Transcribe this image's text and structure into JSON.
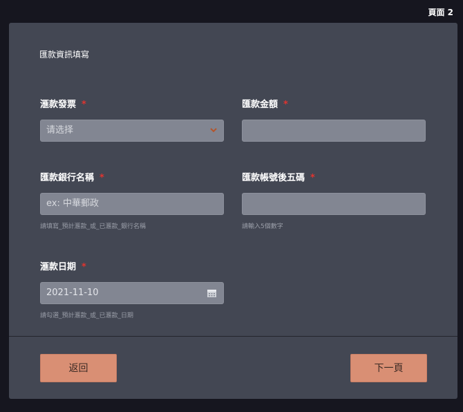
{
  "header": {
    "page_label": "頁面 2"
  },
  "form": {
    "section_title": "匯款資訊填寫",
    "fields": {
      "invoice": {
        "label": "滙款發票",
        "required": "*",
        "placeholder": "请选择",
        "icon": "chevron-down-icon"
      },
      "amount": {
        "label": "匯款金額",
        "required": "*",
        "value": ""
      },
      "bank_name": {
        "label": "匯款銀行名稱",
        "required": "*",
        "placeholder": "ex: 中華郵政",
        "help": "請填寫_預計滙款_或_已滙款_銀行名稱"
      },
      "account_last5": {
        "label": "匯款帳號後五碼",
        "required": "*",
        "value": "",
        "help": "請輸入5個數字"
      },
      "date": {
        "label": "滙款日期",
        "required": "*",
        "value": "2021-11-10",
        "icon": "calendar-icon",
        "help": "請勾選_預計滙款_或_已滙款_日期"
      }
    }
  },
  "footer": {
    "back_label": "返回",
    "next_label": "下一頁"
  },
  "colors": {
    "background": "#16161f",
    "card": "#434753",
    "input": "#828692",
    "button": "#d98f74",
    "required": "#e0342f",
    "chevron": "#b5542a"
  }
}
